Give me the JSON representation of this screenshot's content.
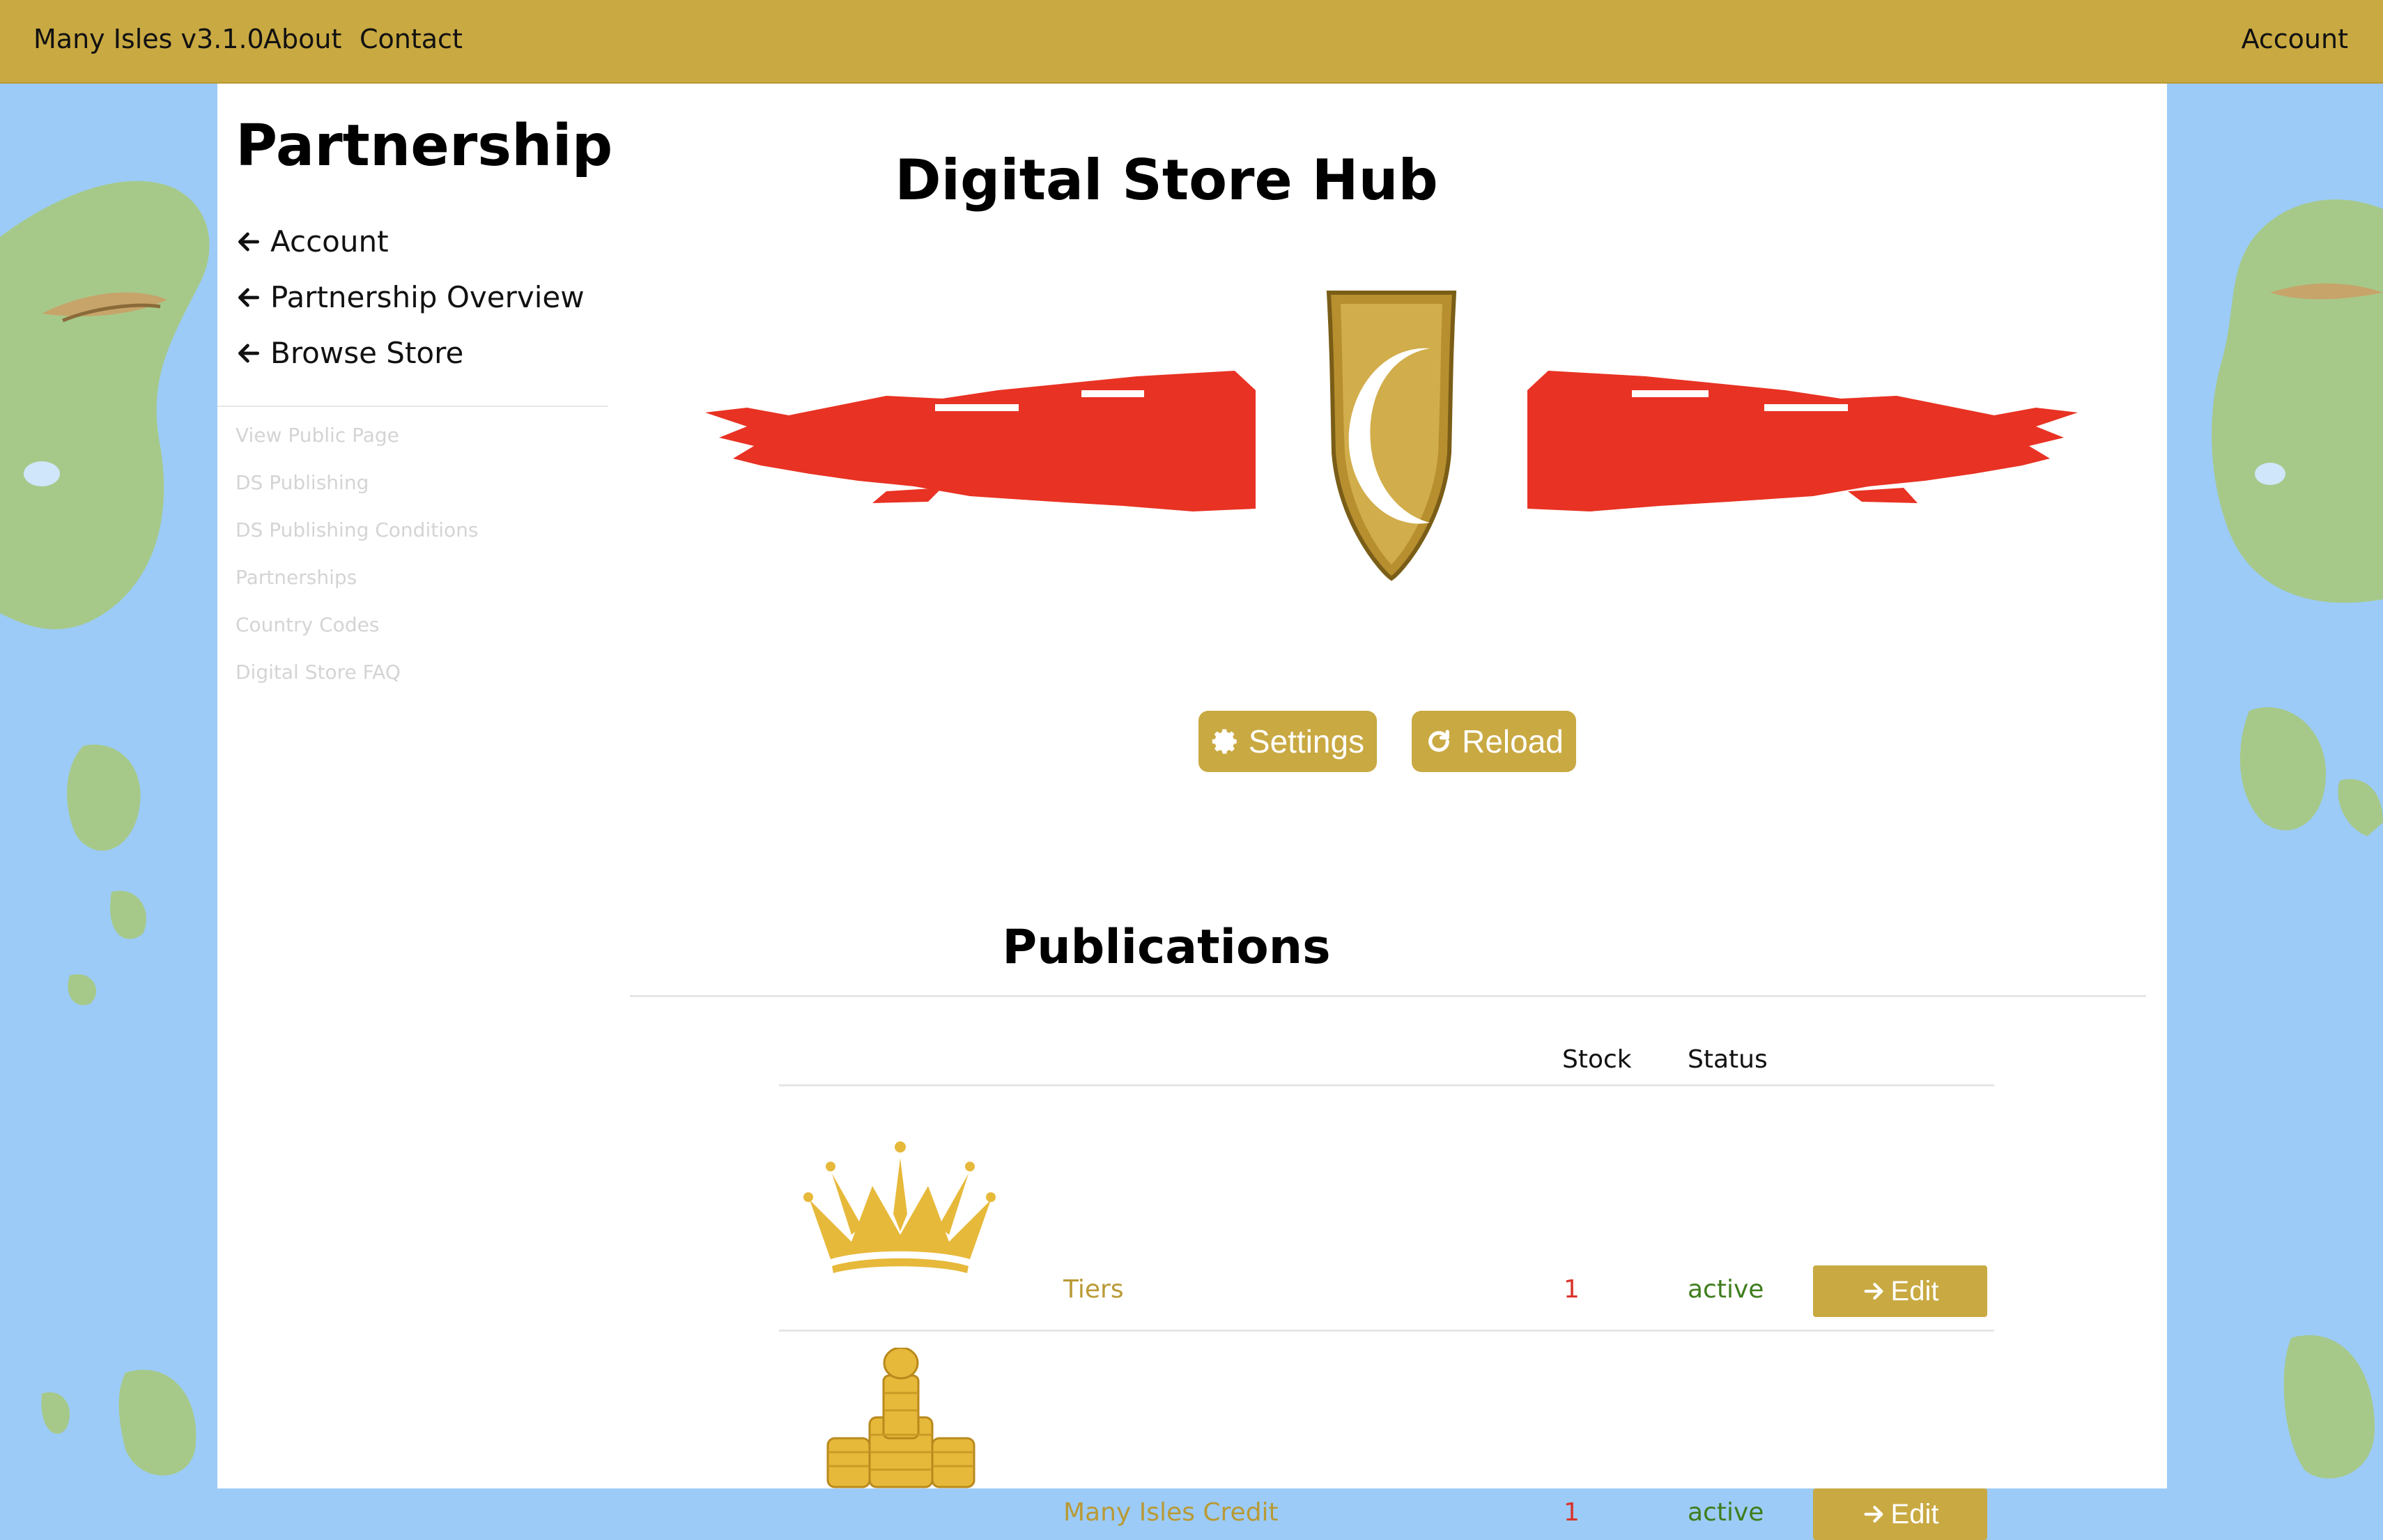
{
  "topbar": {
    "brand": "Many Isles v3.1.0",
    "about": "About",
    "contact": "Contact",
    "account": "Account"
  },
  "sidebar": {
    "title": "Partnership",
    "back_links": [
      "Account",
      "Partnership Overview",
      "Browse Store"
    ],
    "sub_links": [
      "View Public Page",
      "DS Publishing",
      "DS Publishing Conditions",
      "Partnerships",
      "Country Codes",
      "Digital Store FAQ"
    ]
  },
  "main": {
    "title": "Digital Store Hub",
    "settings_label": "Settings",
    "reload_label": "Reload",
    "publications_title": "Publications"
  },
  "table": {
    "headers": {
      "image": "",
      "name": "",
      "stock": "Stock",
      "status": "Status"
    },
    "rows": [
      {
        "name": "Tiers",
        "stock": "1",
        "status": "active",
        "edit_label": "Edit",
        "icon": "crown-icon"
      },
      {
        "name": "Many Isles Credit",
        "stock": "1",
        "status": "active",
        "edit_label": "Edit",
        "icon": "coin-stack-icon"
      }
    ]
  },
  "colors": {
    "gold": "#c9a942",
    "sea": "#9ccbf7",
    "red_banner": "#e83223",
    "active_green": "#3f7d1d",
    "stock_red": "#d9342b"
  }
}
